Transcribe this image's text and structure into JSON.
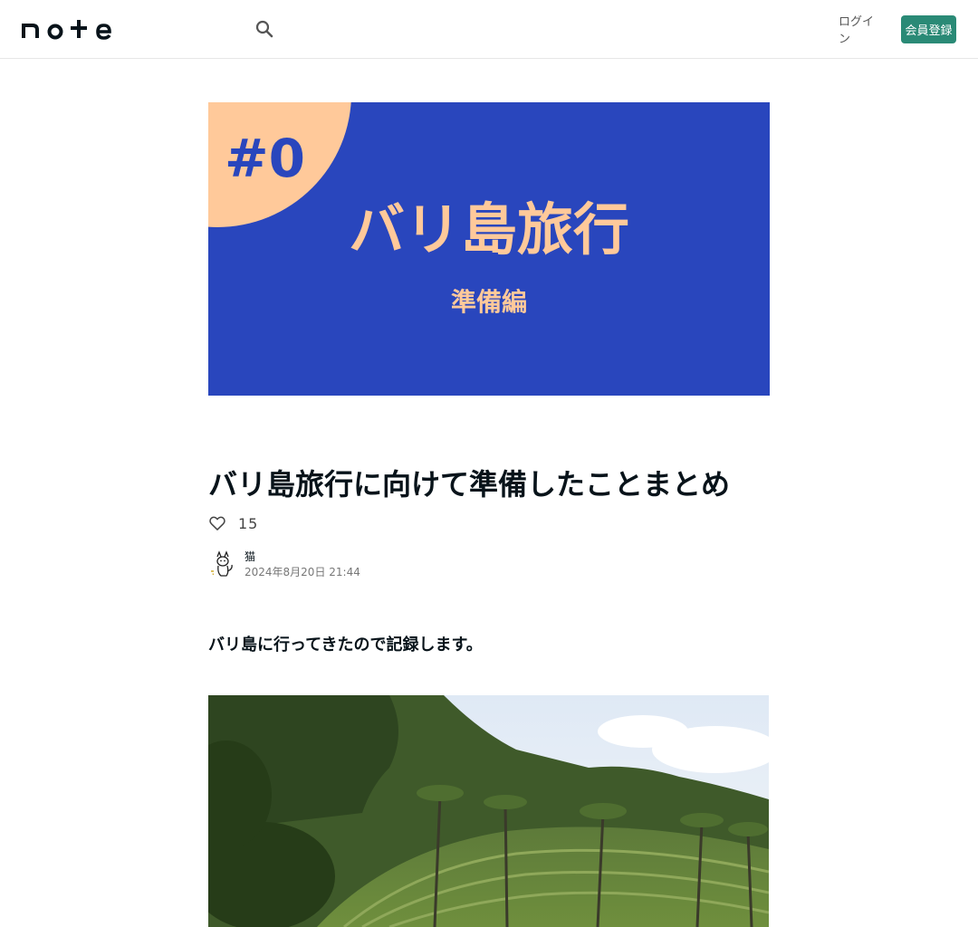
{
  "header": {
    "logo_text": "note",
    "search_icon": "search-icon",
    "login_label": "ログイン",
    "signup_label": "会員登録"
  },
  "cover": {
    "badge": "#0",
    "headline": "バリ島旅行",
    "subheadline": "準備編",
    "colors": {
      "background": "#2946bd",
      "accent": "#ffc99a"
    }
  },
  "article": {
    "title": "バリ島旅行に向けて準備したことまとめ",
    "like_icon": "heart-outline-icon",
    "like_count": "15",
    "author_name": "猫",
    "date": "2024年8月20日 21:44",
    "lead_text": "バリ島に行ってきたので記録します。"
  },
  "colors": {
    "brand_green": "#2a8a76",
    "text": "#08131a"
  }
}
